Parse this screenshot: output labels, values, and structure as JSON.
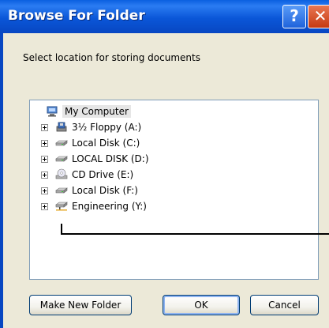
{
  "window": {
    "title": "Browse For Folder",
    "help_glyph": "?",
    "close_glyph": "✕"
  },
  "prompt": "Select location for storing documents",
  "tree": {
    "root": {
      "label": "My Computer",
      "icon": "computer-icon"
    },
    "items": [
      {
        "label": "3½ Floppy (A:)",
        "icon": "floppy-drive-icon"
      },
      {
        "label": "Local Disk (C:)",
        "icon": "hard-disk-icon"
      },
      {
        "label": "LOCAL DISK (D:)",
        "icon": "hard-disk-icon"
      },
      {
        "label": "CD Drive (E:)",
        "icon": "cd-drive-icon"
      },
      {
        "label": "Local Disk (F:)",
        "icon": "hard-disk-icon"
      },
      {
        "label": "Engineering (Y:)",
        "icon": "network-drive-icon"
      }
    ]
  },
  "buttons": {
    "new_folder": "Make New Folder",
    "ok": "OK",
    "cancel": "Cancel"
  },
  "colors": {
    "titlebar": "#0a56d8",
    "dialog_bg": "#ece9d8",
    "close_button": "#d84a20"
  }
}
